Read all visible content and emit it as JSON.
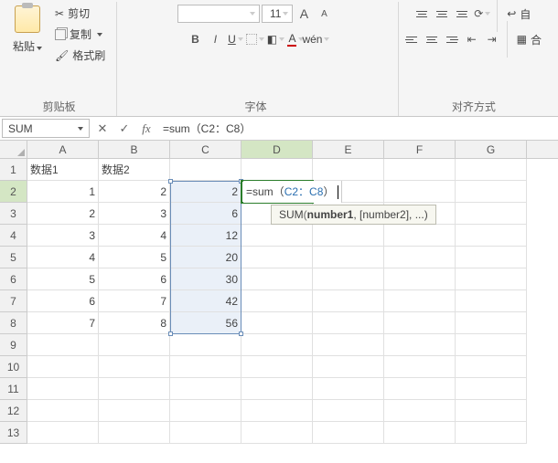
{
  "ribbon": {
    "clipboard": {
      "paste": "粘贴",
      "cut": "剪切",
      "copy": "复制",
      "format_painter": "格式刷",
      "group": "剪贴板"
    },
    "font": {
      "size": "11",
      "inc": "A",
      "dec": "A",
      "bold": "B",
      "italic": "I",
      "underline": "U",
      "wen": "wén",
      "group": "字体"
    },
    "align": {
      "wrap": "自",
      "merge": "合",
      "group": "对齐方式"
    }
  },
  "formula_bar": {
    "name": "SUM",
    "cancel": "✕",
    "enter": "✓",
    "fx": "fx",
    "formula": "=sum（C2：C8）"
  },
  "columns": [
    "A",
    "B",
    "C",
    "D",
    "E",
    "F",
    "G"
  ],
  "rows": [
    {
      "n": "1",
      "A": "数据1",
      "B": "数据2",
      "C": "",
      "D": "",
      "E": "",
      "F": "",
      "G": ""
    },
    {
      "n": "2",
      "A": "1",
      "B": "2",
      "C": "2",
      "D": "",
      "E": "",
      "F": "",
      "G": ""
    },
    {
      "n": "3",
      "A": "2",
      "B": "3",
      "C": "6",
      "D": "",
      "E": "",
      "F": "",
      "G": ""
    },
    {
      "n": "4",
      "A": "3",
      "B": "4",
      "C": "12",
      "D": "",
      "E": "",
      "F": "",
      "G": ""
    },
    {
      "n": "5",
      "A": "4",
      "B": "5",
      "C": "20",
      "D": "",
      "E": "",
      "F": "",
      "G": ""
    },
    {
      "n": "6",
      "A": "5",
      "B": "6",
      "C": "30",
      "D": "",
      "E": "",
      "F": "",
      "G": ""
    },
    {
      "n": "7",
      "A": "6",
      "B": "7",
      "C": "42",
      "D": "",
      "E": "",
      "F": "",
      "G": ""
    },
    {
      "n": "8",
      "A": "7",
      "B": "8",
      "C": "56",
      "D": "",
      "E": "",
      "F": "",
      "G": ""
    },
    {
      "n": "9",
      "A": "",
      "B": "",
      "C": "",
      "D": "",
      "E": "",
      "F": "",
      "G": ""
    },
    {
      "n": "10",
      "A": "",
      "B": "",
      "C": "",
      "D": "",
      "E": "",
      "F": "",
      "G": ""
    },
    {
      "n": "11",
      "A": "",
      "B": "",
      "C": "",
      "D": "",
      "E": "",
      "F": "",
      "G": ""
    },
    {
      "n": "12",
      "A": "",
      "B": "",
      "C": "",
      "D": "",
      "E": "",
      "F": "",
      "G": ""
    },
    {
      "n": "13",
      "A": "",
      "B": "",
      "C": "",
      "D": "",
      "E": "",
      "F": "",
      "G": ""
    }
  ],
  "inline_edit": {
    "pre": "=sum（",
    "ref": "C2：C8",
    "post": "）"
  },
  "tooltip": {
    "fn": "SUM",
    "arg1": "number1",
    "rest": ", [number2], ...)"
  }
}
